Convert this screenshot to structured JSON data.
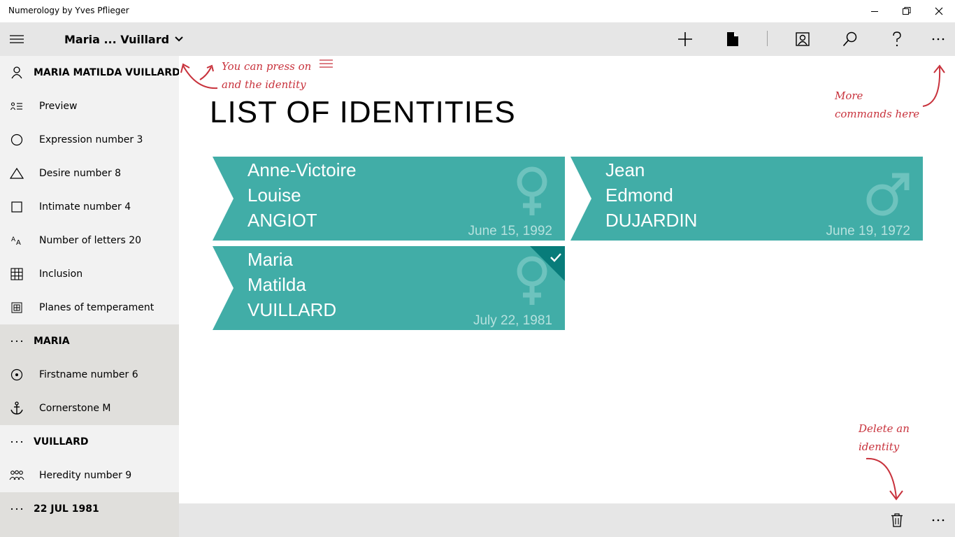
{
  "window": {
    "title": "Numerology by Yves Pflieger"
  },
  "commandbar": {
    "identity_selector": "Maria ... Vuillard",
    "buttons": [
      "add-icon",
      "document-icon",
      "identity-card-icon",
      "search-icon",
      "help-icon",
      "more-icon"
    ]
  },
  "sidebar": {
    "identity_header": "MARIA MATILDA VUILLARD",
    "items": [
      {
        "label": "Preview",
        "icon": "preview-icon"
      },
      {
        "label": "Expression number 3",
        "icon": "circle-icon"
      },
      {
        "label": "Desire number 8",
        "icon": "triangle-icon"
      },
      {
        "label": "Intimate number 4",
        "icon": "square-icon"
      },
      {
        "label": "Number of letters 20",
        "icon": "letters-icon"
      },
      {
        "label": "Inclusion",
        "icon": "grid-icon"
      },
      {
        "label": "Planes of temperament",
        "icon": "planes-icon"
      }
    ],
    "firstname_header": "MARIA",
    "firstname_items": [
      {
        "label": "Firstname number 6",
        "icon": "target-icon"
      },
      {
        "label": "Cornerstone M",
        "icon": "anchor-icon"
      }
    ],
    "lastname_header": "VUILLARD",
    "lastname_items": [
      {
        "label": "Heredity number 9",
        "icon": "family-icon"
      }
    ],
    "date_header": "22 JUL 1981"
  },
  "main": {
    "title": "LIST OF IDENTITIES",
    "identities": [
      {
        "line1": "Anne-Victoire",
        "line2": "Louise",
        "line3": "ANGIOT",
        "date": "June 15, 1992",
        "gender": "female",
        "selected": false
      },
      {
        "line1": "Jean",
        "line2": "Edmond",
        "line3": "DUJARDIN",
        "date": "June 19, 1972",
        "gender": "male",
        "selected": false
      },
      {
        "line1": "Maria",
        "line2": "Matilda",
        "line3": "VUILLARD",
        "date": "July 22, 1981",
        "gender": "female",
        "selected": true
      }
    ]
  },
  "annotations": {
    "hamburger_line1": "You can press on",
    "hamburger_line2": "and the identity",
    "more_line1": "More",
    "more_line2": "commands here",
    "delete_line1": "Delete an",
    "delete_line2": "identity"
  },
  "colors": {
    "card": "#41ada7",
    "selected_corner": "#087c7a",
    "annotation": "#c8323c"
  }
}
